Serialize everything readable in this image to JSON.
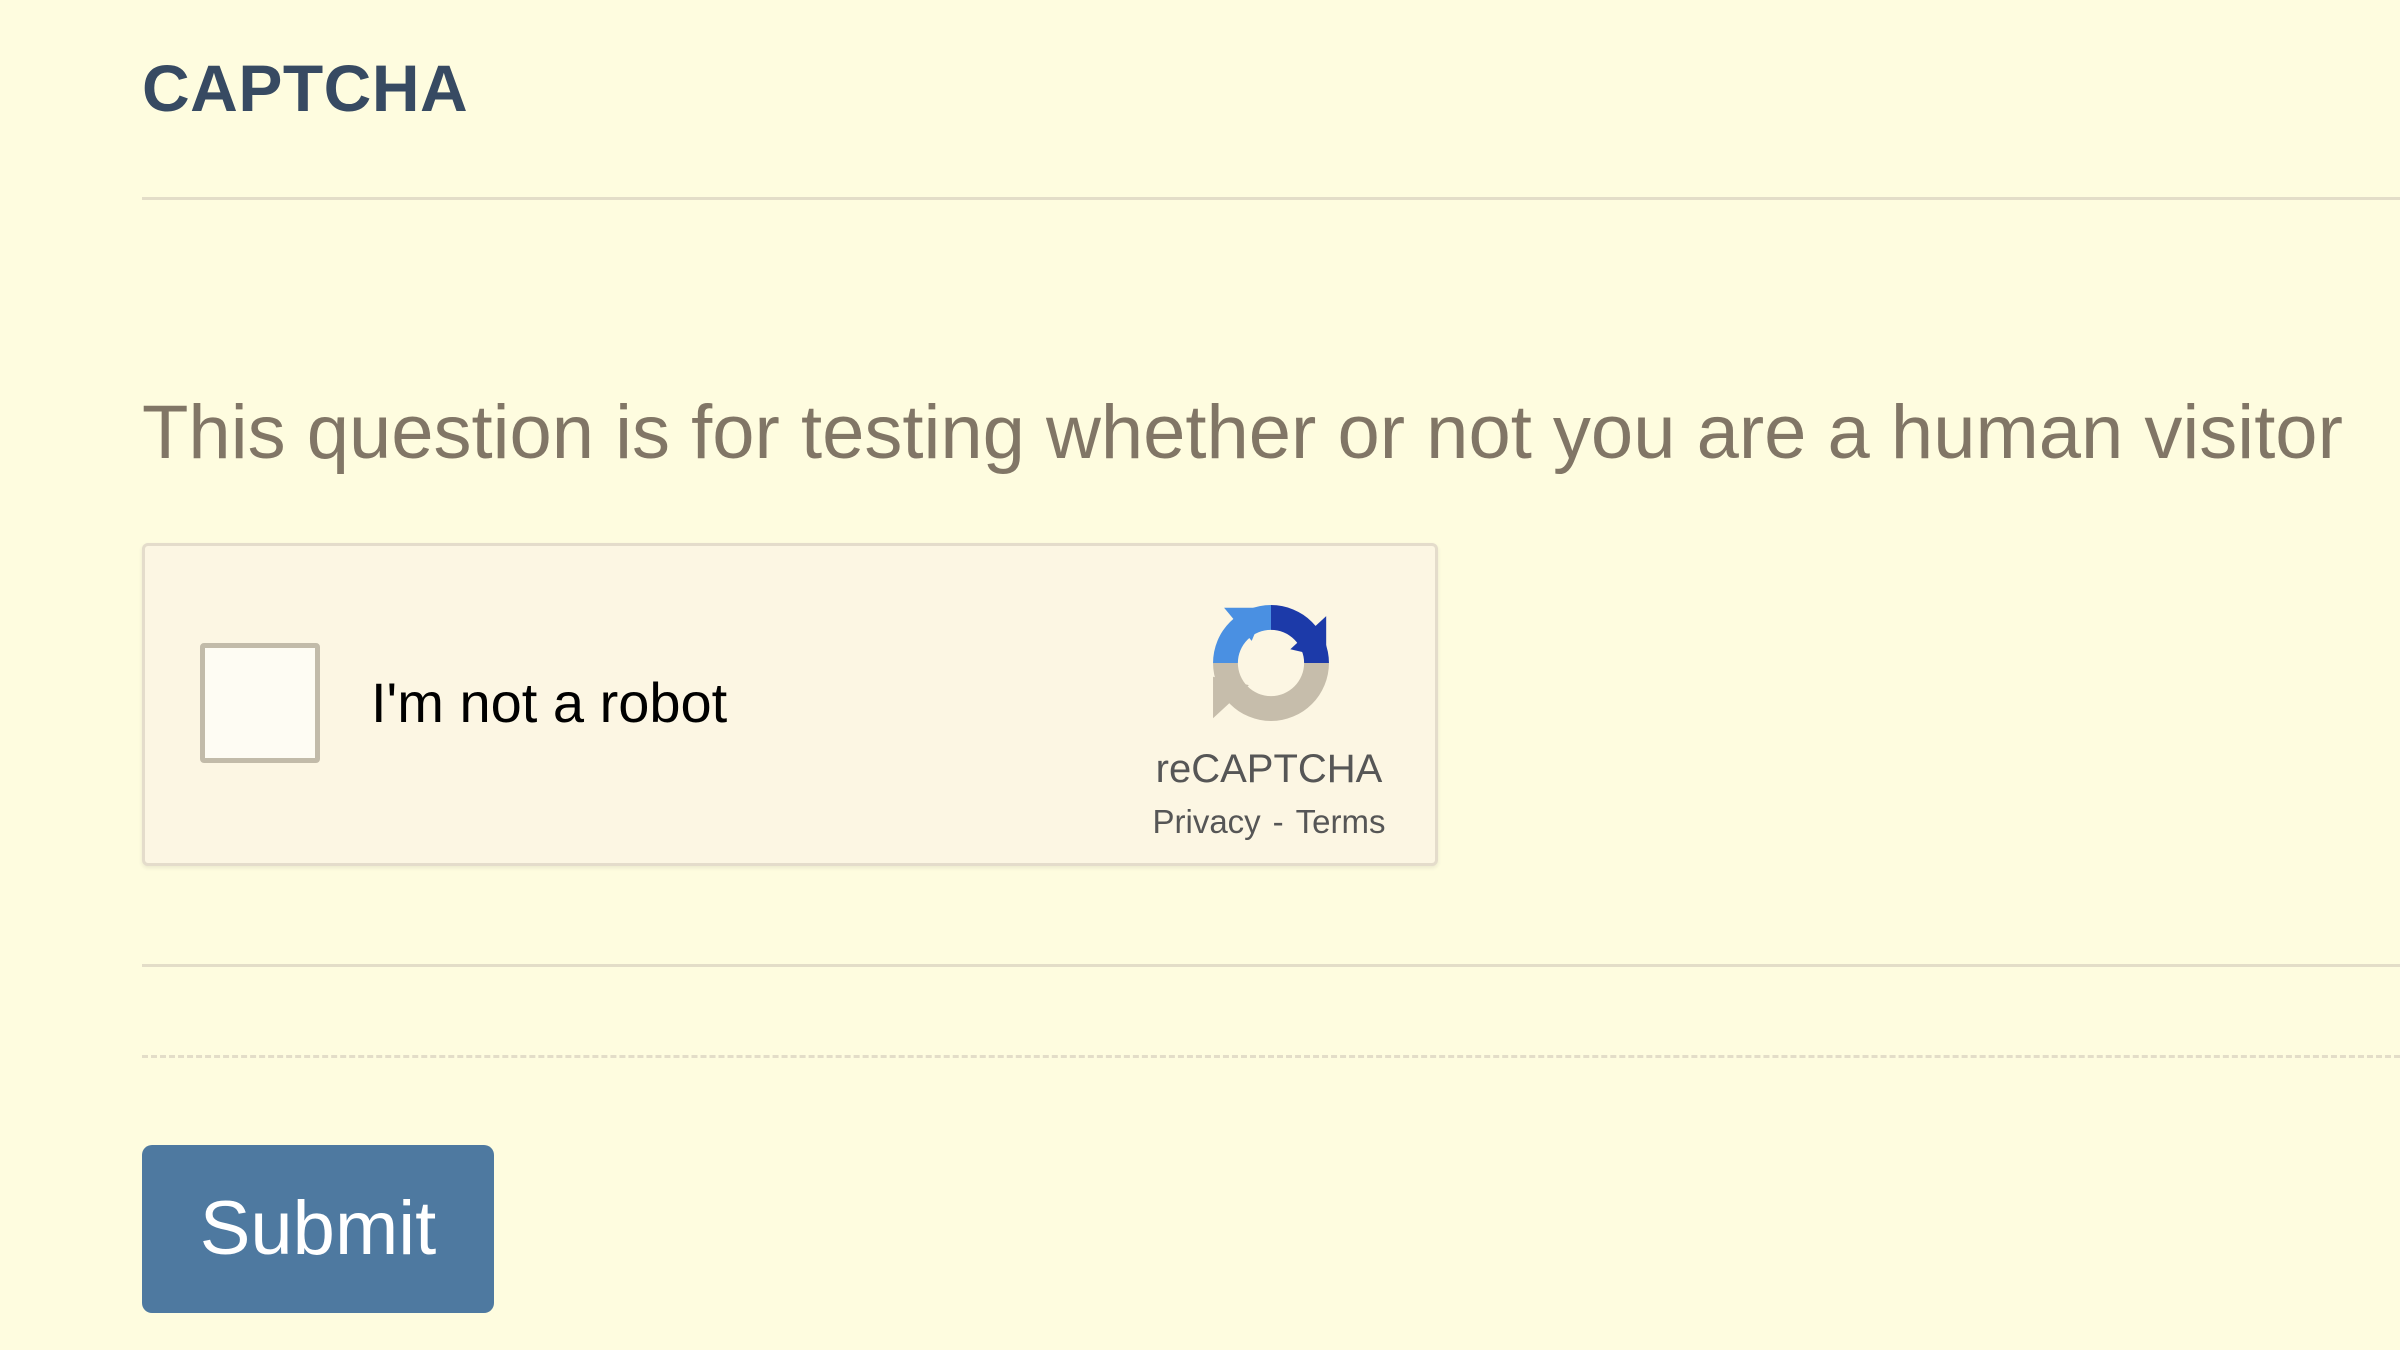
{
  "section": {
    "title": "CAPTCHA"
  },
  "captcha": {
    "question": "This question is for testing whether or not you are a human visitor",
    "widget": {
      "checkbox_label": "I'm not a robot",
      "checked": false,
      "brand": "reCAPTCHA",
      "privacy_link": "Privacy",
      "separator": "-",
      "terms_link": "Terms",
      "logo_icon": "recaptcha-logo-icon"
    }
  },
  "form": {
    "submit_label": "Submit"
  },
  "colors": {
    "background": "#fefcdf",
    "title": "#374a62",
    "question_text": "#817666",
    "widget_background": "#fcf6e3",
    "button_background": "#4e79a0",
    "button_text": "#ffffff",
    "logo_blue_light": "#4a90e2",
    "logo_blue_dark": "#1c3aa9",
    "logo_gray": "#c6bdab"
  }
}
